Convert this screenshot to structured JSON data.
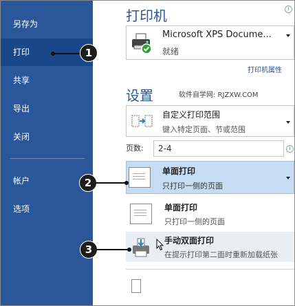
{
  "sidebar": {
    "items": [
      {
        "label": "另存为"
      },
      {
        "label": "打印"
      },
      {
        "label": "共享"
      },
      {
        "label": "导出"
      },
      {
        "label": "关闭"
      },
      {
        "label": "帐户"
      },
      {
        "label": "选项"
      }
    ]
  },
  "printer": {
    "section_title": "打印机",
    "name": "Microsoft XPS Docume...",
    "status": "就绪",
    "properties_link": "打印机属性"
  },
  "settings": {
    "section_title": "设置",
    "watermark": "软件自学网: RJZXW.COM",
    "range_main": "自定义打印范围",
    "range_sub": "键入特定页面、节或范围",
    "pages_label": "页数:",
    "pages_value": "2-4",
    "sides_selected_main": "单面打印",
    "sides_selected_sub": "只打印一侧的页面",
    "options": [
      {
        "main": "单面打印",
        "sub": "只打印一侧的页面"
      },
      {
        "main": "手动双面打印",
        "sub": "在提示打印第二面时重新加载纸张"
      }
    ]
  },
  "callouts": [
    "1",
    "2",
    "3"
  ],
  "info_glyph": "i",
  "colors": {
    "sidebar": "#2b579a",
    "selected": "#c5dcf3",
    "accent": "#2b579a"
  }
}
